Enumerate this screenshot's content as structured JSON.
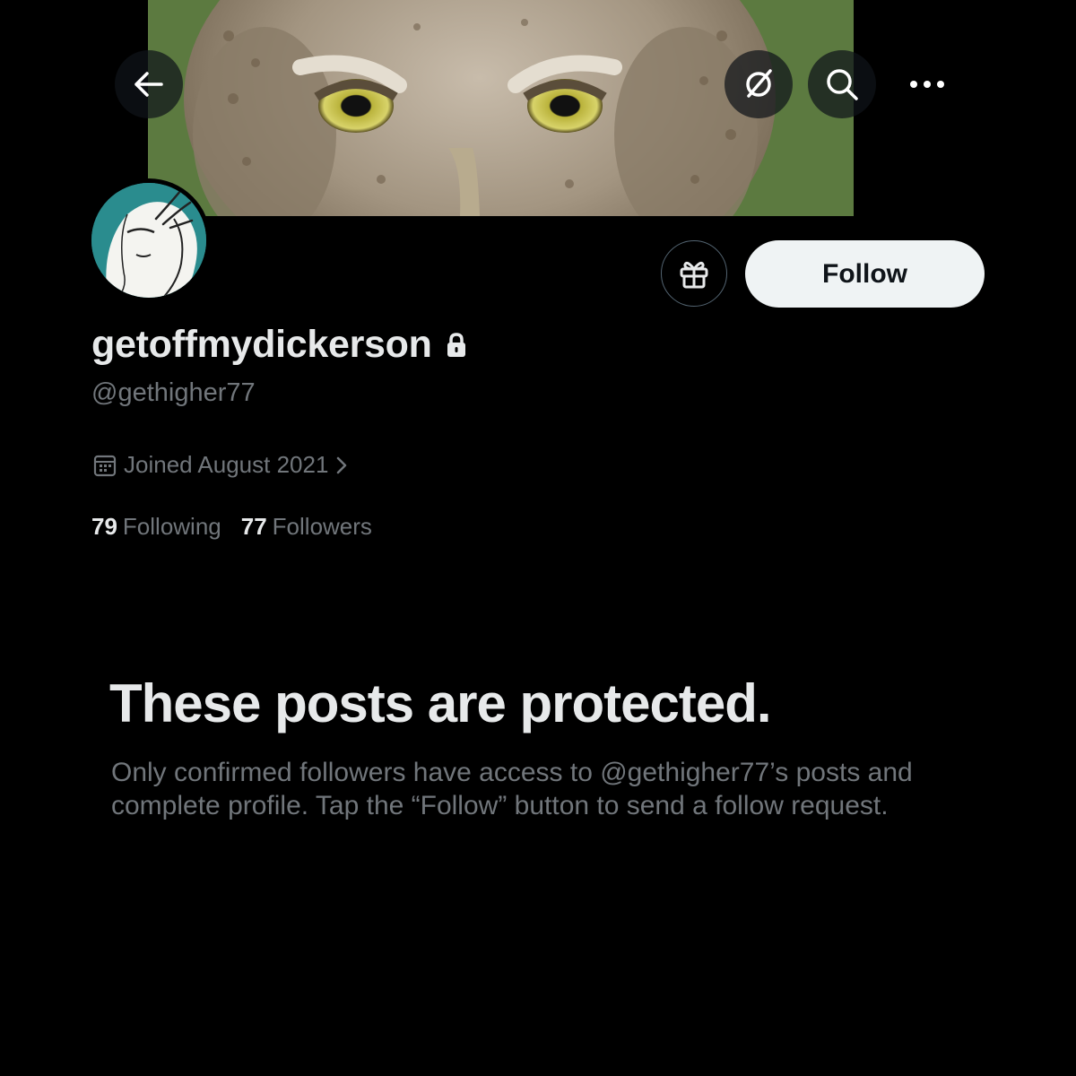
{
  "header": {
    "back_icon": "arrow-left-icon",
    "grok_icon": "grok-icon",
    "search_icon": "search-icon",
    "more_icon": "more-horizontal-icon"
  },
  "profile": {
    "display_name": "getoffmydickerson",
    "handle": "@gethigher77",
    "joined": "Joined August 2021",
    "following_count": "79",
    "following_label": "Following",
    "followers_count": "77",
    "followers_label": "Followers",
    "protected": true
  },
  "actions": {
    "gift_icon": "gift-icon",
    "follow_label": "Follow"
  },
  "protected_notice": {
    "title": "These posts are protected.",
    "body": "Only confirmed followers have access to @gethigher77’s posts and complete profile. Tap the “Follow” button to send a follow request."
  },
  "colors": {
    "background": "#000000",
    "primary_text": "#e7e9ea",
    "secondary_text": "#71767b",
    "follow_button_bg": "#eff3f4",
    "follow_button_text": "#0f1419"
  }
}
